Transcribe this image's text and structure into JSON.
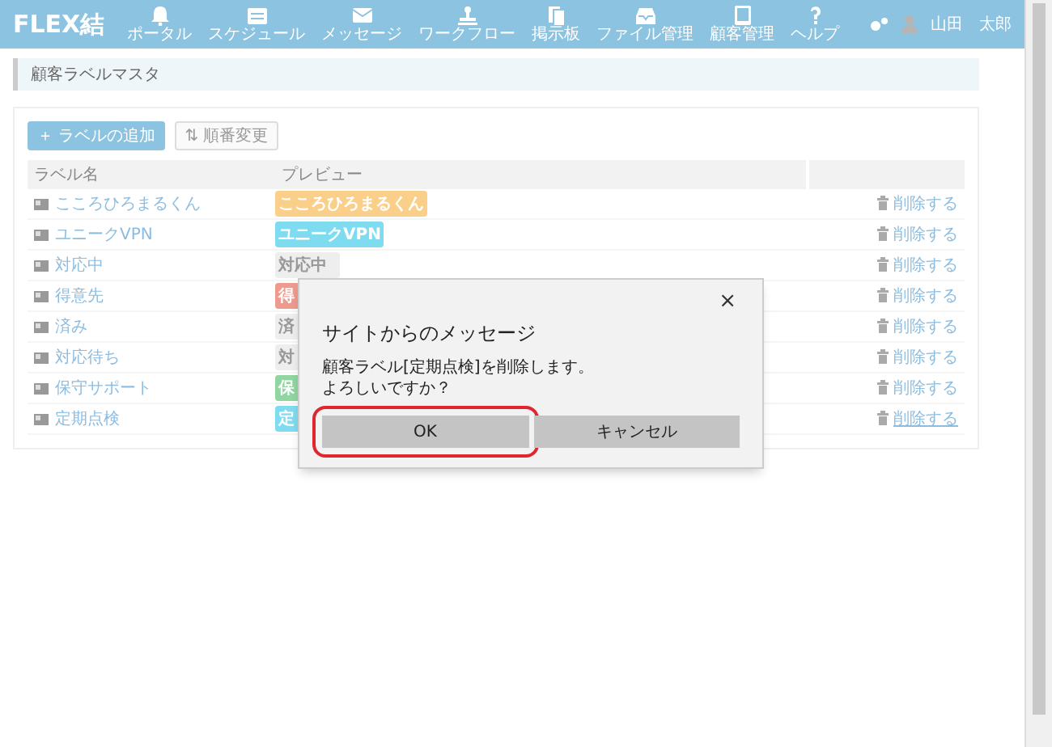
{
  "header": {
    "logo": "FLEX結",
    "nav": [
      {
        "label": "ポータル"
      },
      {
        "label": "スケジュール"
      },
      {
        "label": "メッセージ"
      },
      {
        "label": "ワークフロー"
      },
      {
        "label": "掲示板"
      },
      {
        "label": "ファイル管理"
      },
      {
        "label": "顧客管理"
      },
      {
        "label": "ヘルプ"
      }
    ],
    "user": "山田　太郎"
  },
  "page_title": "顧客ラベルマスタ",
  "toolbar": [
    {
      "label": "ラベルの追加",
      "kind": "primary",
      "icon": "＋"
    },
    {
      "label": "順番変更",
      "kind": "secondary",
      "icon": "⇅"
    }
  ],
  "table": {
    "columns": [
      "ラベル名",
      "プレビュー"
    ],
    "rows": [
      {
        "name": "こころひろまるくん",
        "preview": "こころひろまるくん",
        "color": "#f9cf8a",
        "action": "削除する",
        "hovered": false
      },
      {
        "name": "ユニークVPN",
        "preview": "ユニークVPN",
        "color": "#7fdcf0",
        "action": "削除する",
        "hovered": false
      },
      {
        "name": "対応中",
        "preview": "対応中",
        "color": "#eeeeee",
        "action": "削除する",
        "hovered": false
      },
      {
        "name": "得意先",
        "preview": "得",
        "color": "#ef9a8e",
        "action": "削除する",
        "hovered": false
      },
      {
        "name": "済み",
        "preview": "済",
        "color": "#eeeeee",
        "action": "削除する",
        "hovered": false
      },
      {
        "name": "対応待ち",
        "preview": "対",
        "color": "#eeeeee",
        "action": "削除する",
        "hovered": false
      },
      {
        "name": "保守サポート",
        "preview": "保",
        "color": "#8fd6a0",
        "action": "削除する",
        "hovered": false
      },
      {
        "name": "定期点検",
        "preview": "定",
        "color": "#7fdcf0",
        "action": "削除する",
        "hovered": true
      }
    ]
  },
  "dialog": {
    "close": "×",
    "title": "サイトからのメッセージ",
    "message_lines": [
      "顧客ラベル[定期点検]を削除します。",
      "よろしいですか？"
    ],
    "buttons": [
      {
        "label": "OK",
        "highlighted": true
      },
      {
        "label": "キャンセル",
        "highlighted": false
      }
    ]
  }
}
